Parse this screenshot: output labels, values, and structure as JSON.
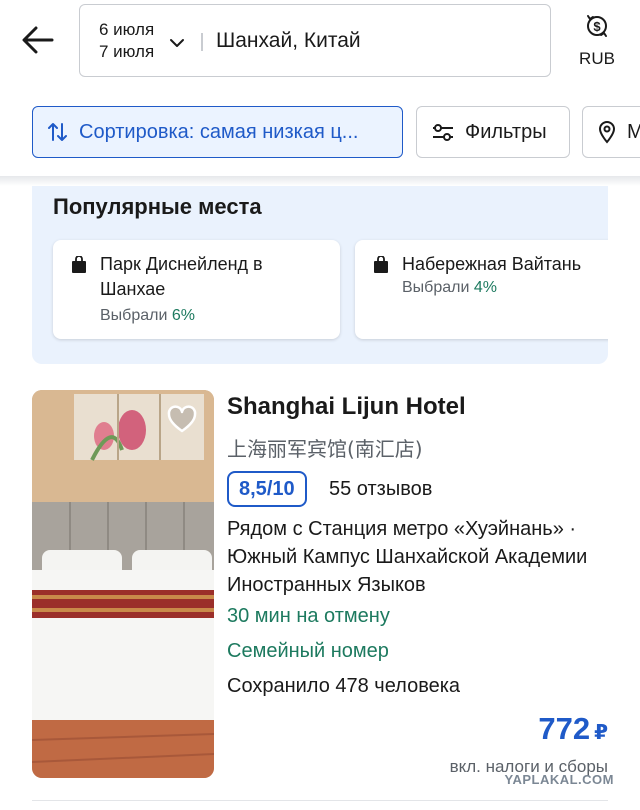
{
  "search": {
    "checkin": "6 июля",
    "checkout": "7 июля",
    "destination": "Шанхай, Китай",
    "currency": "RUB"
  },
  "chips": {
    "sort": "Сортировка: самая низкая ц...",
    "filters": "Фильтры",
    "map": "М"
  },
  "popular": {
    "title": "Популярные места",
    "picked_prefix": "Выбрали",
    "places": [
      {
        "name": "Парк Диснейленд в Шанхае",
        "percent": "6%"
      },
      {
        "name": "Набережная Вайтань",
        "percent": "4%"
      }
    ]
  },
  "hotel": {
    "name": "Shanghai Lijun Hotel",
    "local_name": "上海丽军宾馆(南汇店)",
    "rating": "8,5",
    "rating_scale": "/10",
    "reviews": "55 отзывов",
    "location": "Рядом с Станция метро «Хуэйнань» · Южный Кампус Шанхайской Академии Иностранных Языков",
    "cancellation": "30 мин на отмену",
    "room_type": "Семейный номер",
    "saved_by": "Сохранило 478 человека",
    "price": "772",
    "currency_symbol": "₽",
    "tax_note": "вкл. налоги и сборы"
  },
  "watermark": "YAPLAKAL.COM",
  "colors": {
    "accent": "#1f5ac8",
    "accent_bg": "#ebf3ff",
    "positive": "#1d7a5f",
    "popular_bg": "#eaf2fd"
  },
  "icons": {
    "back": "arrow-left-icon",
    "chevron": "chevron-down-icon",
    "currency": "currency-exchange-icon",
    "sort": "sort-arrows-icon",
    "filter": "sliders-icon",
    "map": "map-pin-icon",
    "place": "shopping-bag-icon",
    "favorite": "heart-icon"
  }
}
